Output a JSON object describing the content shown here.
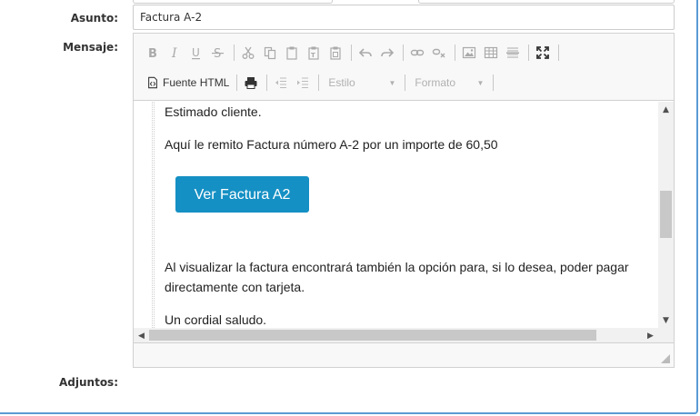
{
  "form": {
    "subject_label": "Asunto:",
    "subject_value": "Factura A-2",
    "message_label": "Mensaje:",
    "attachments_label": "Adjuntos:"
  },
  "toolbar": {
    "source_label": "Fuente HTML",
    "style_combo": "Estilo",
    "format_combo": "Formato"
  },
  "message": {
    "greeting": "Estimado cliente.",
    "intro": "Aquí le remito Factura número A-2 por un importe de 60,50",
    "cta_label": "Ver Factura A2",
    "body_line1": "Al visualizar la factura encontrará también la opción para, si lo desea, poder pagar",
    "body_line2": "directamente con tarjeta.",
    "closing": "Un cordial saludo."
  },
  "colors": {
    "cta_background": "#1590c4",
    "panel_border": "#5b9bd5"
  }
}
